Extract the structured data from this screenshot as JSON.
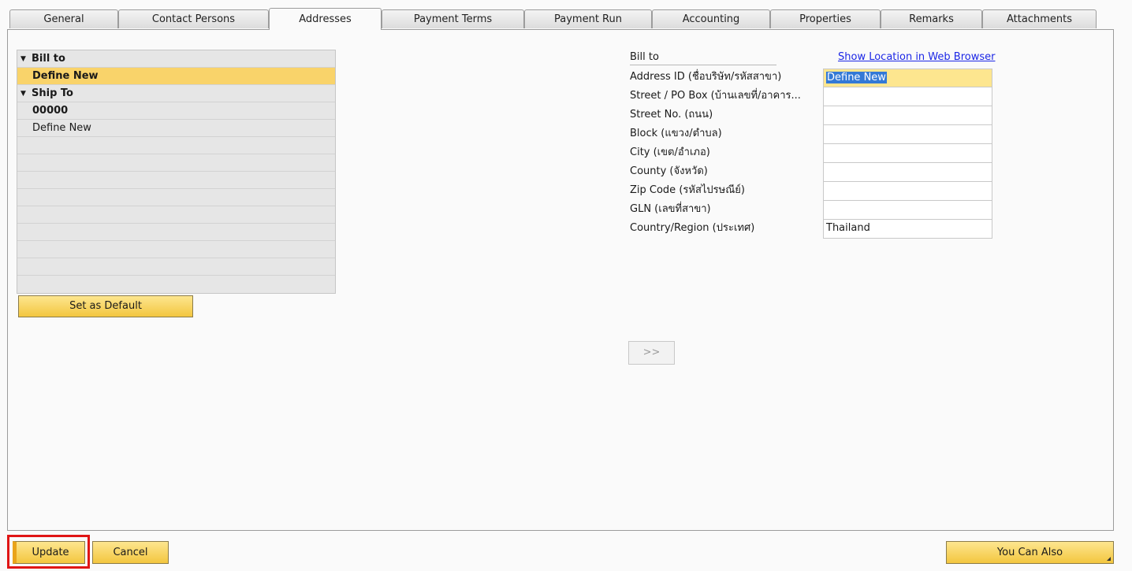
{
  "tabs": [
    {
      "label": "General"
    },
    {
      "label": "Contact Persons"
    },
    {
      "label": "Addresses"
    },
    {
      "label": "Payment Terms"
    },
    {
      "label": "Payment Run"
    },
    {
      "label": "Accounting"
    },
    {
      "label": "Properties"
    },
    {
      "label": "Remarks"
    },
    {
      "label": "Attachments"
    }
  ],
  "active_tab": "Addresses",
  "tree": {
    "bill_to_header": "Bill to",
    "bill_to_define_new": "Define New",
    "ship_to_header": "Ship To",
    "ship_to_code": "00000",
    "ship_to_define_new": "Define New"
  },
  "set_default_label": "Set as Default",
  "move_button_label": ">>",
  "form": {
    "header": "Bill to",
    "map_link": "Show Location in Web Browser",
    "fields": [
      {
        "label": "Address ID (ชื่อบริษัท/รหัสสาขา)",
        "value": "Define New"
      },
      {
        "label": "Street / PO Box (บ้านเลขที่/อาคาร...",
        "value": ""
      },
      {
        "label": "Street No. (ถนน)",
        "value": ""
      },
      {
        "label": "Block (แขวง/ตำบล)",
        "value": ""
      },
      {
        "label": "City (เขต/อำเภอ)",
        "value": ""
      },
      {
        "label": "County (จังหวัด)",
        "value": ""
      },
      {
        "label": "Zip Code (รหัสไปรษณีย์)",
        "value": ""
      },
      {
        "label": "GLN (เลขที่สาขา)",
        "value": ""
      },
      {
        "label": "Country/Region (ประเทศ)",
        "value": "Thailand"
      }
    ]
  },
  "footer": {
    "update_label": "Update",
    "cancel_label": "Cancel",
    "you_can_also_label": "You Can Also"
  }
}
